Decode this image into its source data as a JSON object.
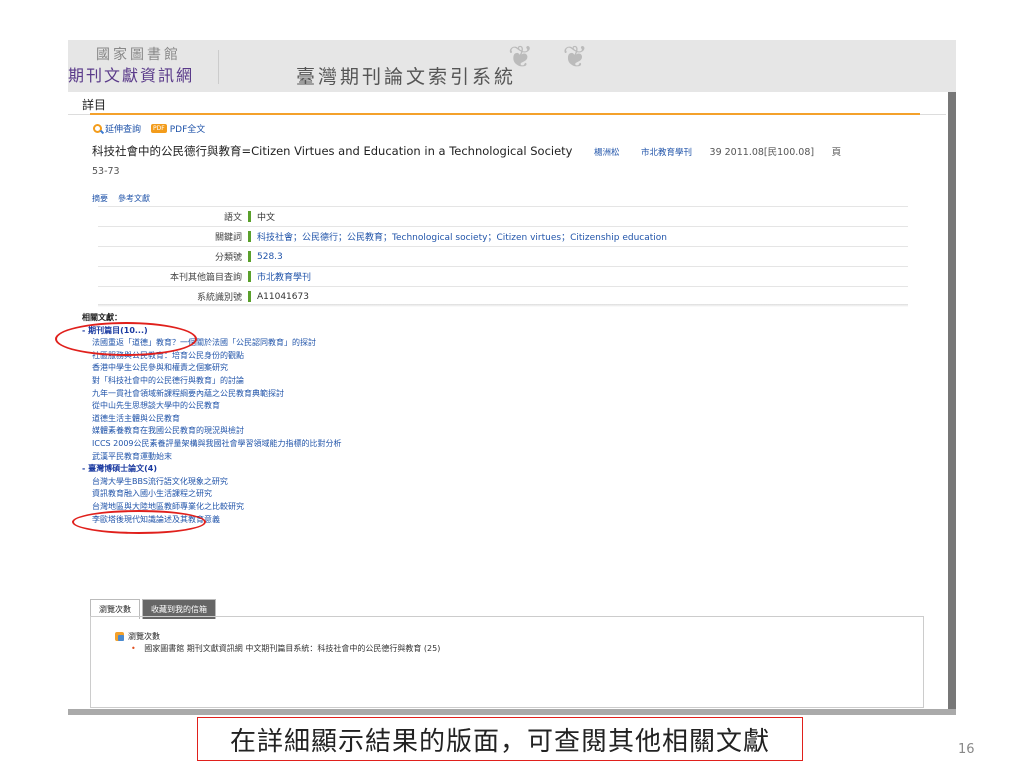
{
  "banner": {
    "org_top": "國家圖書館",
    "org_name": "期刊文獻資訊網",
    "system_title": "臺灣期刊論文索引系統"
  },
  "panel": {
    "title": "詳目"
  },
  "toolbar": {
    "extended_search": "延伸查詢",
    "pdf_fulltext": "PDF全文"
  },
  "article": {
    "title": "科技社會中的公民德行與教育=Citizen Virtues and Education in a Technological Society",
    "author": "楊洲松",
    "journal": "市北教育學刊",
    "issue": "39 2011.08[民100.08]",
    "pages_prefix": "頁",
    "pages": "53-73"
  },
  "subtabs": [
    "摘要",
    "參考文獻"
  ],
  "meta": [
    {
      "label": "語文",
      "value": "中文",
      "link": false
    },
    {
      "label": "關鍵詞",
      "value": "科技社會；公民德行；公民教育；Technological society；Citizen virtues；Citizenship education",
      "link": true
    },
    {
      "label": "分類號",
      "value": "528.3",
      "link": true
    },
    {
      "label": "本刊其他篇目查詢",
      "value": "市北教育學刊",
      "link": true
    },
    {
      "label": "系統識別號",
      "value": "A11041673",
      "link": false
    }
  ],
  "related": {
    "heading": "相關文獻：",
    "journal_group": "- 期刊篇目(10...)",
    "journal_items": [
      "法國重返「道德」教育？一個關於法國「公民認同教育」的探討",
      "社區服務與公民教育：培育公民身份的觀點",
      "香港中學生公民參與和權責之個案研究",
      "對「科技社會中的公民德行與教育」的討論",
      "九年一貫社會領域新課程綱要內蘊之公民教育典範探討",
      "從中山先生思想談大學中的公民教育",
      "道德生活主體與公民教育",
      "媒體素養教育在我國公民教育的現況與檢討",
      "ICCS 2009公民素養評量架構與我國社會學習領域能力指標的比對分析",
      "武漢平民教育運動始末"
    ],
    "thesis_group": "- 臺灣博碩士論文(4)",
    "thesis_items": [
      "台灣大學生BBS流行語文化現象之研究",
      "資訊教育融入國小生活課程之研究",
      "台灣地區與大陸地區教師專業化之比較研究",
      "李歐塔後現代知識論述及其教育意義"
    ]
  },
  "bottom_tabs": {
    "views": "瀏覽次數",
    "save_mail": "收藏到我的信箱"
  },
  "stats": {
    "heading": "瀏覽次數",
    "item": "國家圖書館 期刊文獻資訊網 中文期刊篇目系統：科技社會中的公民德行與教育 (25)"
  },
  "caption": "在詳細顯示結果的版面，可查閱其他相關文獻",
  "page_number": "16"
}
